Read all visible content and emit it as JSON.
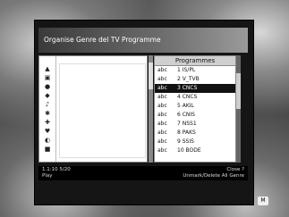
{
  "title": "Organise Genre del TV Programme",
  "left_icons": [
    "film-icon",
    "news-icon",
    "sport-icon",
    "kids-icon",
    "music-icon",
    "science-icon",
    "education-icon",
    "leisure-icon",
    "talk-icon",
    "info-icon"
  ],
  "programmes_header": "Programmes",
  "programmes": [
    {
      "tag": "abc",
      "name": "1 IS/PL"
    },
    {
      "tag": "abc",
      "name": "2 V_TVB"
    },
    {
      "tag": "abc",
      "name": "3 CNCS"
    },
    {
      "tag": "abc",
      "name": "4 CNCS"
    },
    {
      "tag": "abc",
      "name": "5 AKIL"
    },
    {
      "tag": "abc",
      "name": "6 CNIS"
    },
    {
      "tag": "abc",
      "name": "7 NSS1"
    },
    {
      "tag": "abc",
      "name": "8 PAKS"
    },
    {
      "tag": "abc",
      "name": "9 SSIS"
    },
    {
      "tag": "abc",
      "name": "10 BODE"
    }
  ],
  "selected_index": 2,
  "footer": {
    "left_1": "1.1:10  5/20",
    "left_2": "Play",
    "right_1": "Close  ?",
    "right_2": "Unmark/Delete All Genre"
  },
  "badge": "M"
}
